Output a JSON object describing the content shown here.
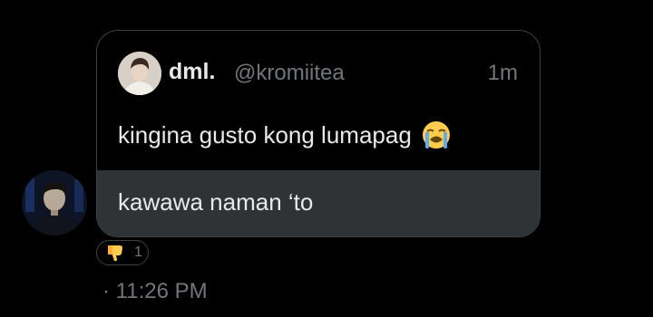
{
  "quoted_tweet": {
    "display_name": "dml.",
    "handle": "@kromiitea",
    "time": "1m",
    "text": "kingina gusto kong lumapag",
    "emoji": "loudly-crying-face-emoji"
  },
  "message": {
    "text": "kawawa naman ‘to"
  },
  "reaction": {
    "emoji": "thumbs-down-emoji",
    "count": "1"
  },
  "timestamp": "· 11:26 PM",
  "colors": {
    "background": "#000000",
    "primary_text": "#e7e9ea",
    "secondary_text": "#71767b",
    "border": "#3e4144",
    "message_bubble": "#2f3336"
  }
}
